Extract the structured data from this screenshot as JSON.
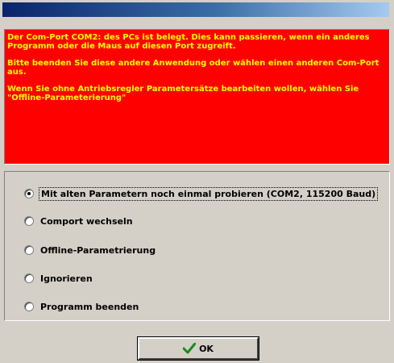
{
  "message": {
    "paragraphs": [
      "Der Com-Port COM2: des PCs ist belegt. Dies kann passieren, wenn ein anderes Programm oder die Maus auf diesen Port zugreift.",
      "Bitte beenden Sie diese andere Anwendung oder wählen einen anderen Com-Port aus.",
      "Wenn Sie ohne Antriebsregler Parametersätze bearbeiten wollen, wählen Sie \"Offline-Parameterierung\""
    ]
  },
  "options": [
    {
      "label": "Mit alten Parametern noch einmal probieren (COM2, 115200 Baud)",
      "checked": true
    },
    {
      "label": "Comport wechseln",
      "checked": false
    },
    {
      "label": "Offline-Parametrierung",
      "checked": false
    },
    {
      "label": "Ignorieren",
      "checked": false
    },
    {
      "label": "Programm beenden",
      "checked": false
    }
  ],
  "ok_button": {
    "label": "OK",
    "icon": "checkmark-icon"
  },
  "colors": {
    "message_bg": "#ff0000",
    "message_text": "#ffff00",
    "check": "#1a8a1a"
  }
}
